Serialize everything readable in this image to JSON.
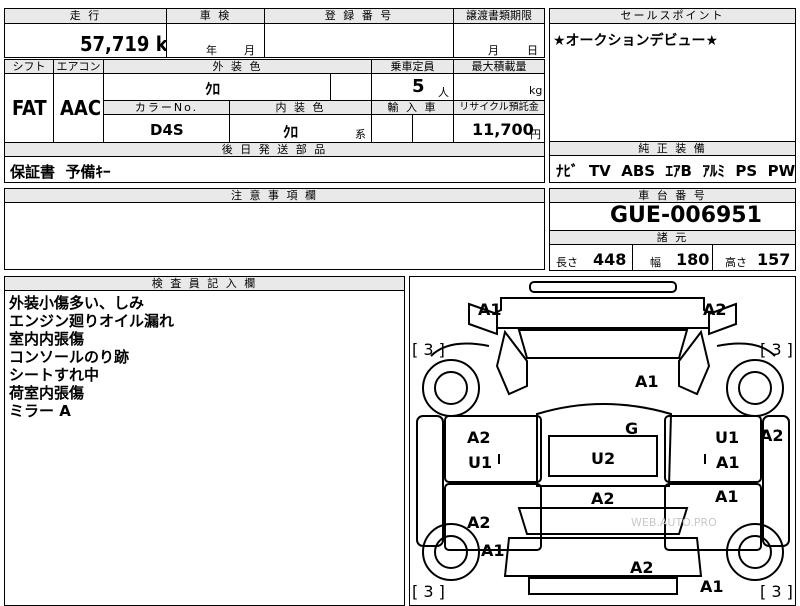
{
  "top": {
    "mileage_label": "走 行",
    "mileage_value": "57,719",
    "mileage_unit": "km",
    "inspection_label": "車 検",
    "inspection_year_unit": "年",
    "inspection_month_unit": "月",
    "registration_label": "登 録 番 号",
    "transfer_label": "譲渡書類期限",
    "transfer_month_unit": "月",
    "transfer_day_unit": "日",
    "sales_point_label": "セールスポイント",
    "sales_point_text": "★オークションデビュー★"
  },
  "specs": {
    "shift_label": "シフト",
    "shift_value": "FAT",
    "ac_label": "エアコン",
    "ac_value": "AAC",
    "exterior_color_label": "外 装 色",
    "exterior_color_value": "ｸﾛ",
    "capacity_label": "乗車定員",
    "capacity_value": "5",
    "capacity_unit": "人",
    "max_load_label": "最大積載量",
    "max_load_unit": "kg",
    "color_no_label": "カラーNo.",
    "color_no_value": "D4S",
    "interior_color_label": "内 装 色",
    "interior_color_value": "ｸﾛ",
    "interior_color_suffix": "系",
    "import_label": "輸 入 車",
    "recycle_label": "リサイクル預託金",
    "recycle_value": "11,700",
    "recycle_unit": "円"
  },
  "parts": {
    "label": "後 日 発 送 部 品",
    "value": "保証書  予備ｷｰ"
  },
  "equipment": {
    "label": "純 正 装 備",
    "value": "ﾅﾋﾞ  TV  ABS  ｴｱB  ｱﾙﾐ  PS  PW"
  },
  "notes": {
    "label": "注 意 事 項 欄"
  },
  "chassis": {
    "label": "車 台 番 号",
    "value": "GUE-006951",
    "dims_label": "諸 元",
    "length_label": "長さ",
    "length_value": "448",
    "width_label": "幅",
    "width_value": "180",
    "height_label": "高さ",
    "height_value": "157"
  },
  "inspector": {
    "label": "検 査 員 記 入 欄",
    "lines": [
      "外装小傷多い、しみ",
      "エンジン廻りオイル漏れ",
      "室内内張傷",
      "コンソールのり跡",
      "シートすれ中",
      "荷室内張傷",
      "ミラー A"
    ]
  },
  "diagram": {
    "watermark": "WEB.AUTO.PRO",
    "marks": [
      "A1",
      "A2",
      "[ 3 ]",
      "[ 3 ]",
      "A1",
      "A2",
      "G",
      "A2",
      "U1",
      "U1",
      "A1",
      "U2",
      "A2",
      "A1",
      "A2",
      "A1",
      "A2",
      "[ 3 ]",
      "[ 3 ]",
      "A1"
    ]
  }
}
